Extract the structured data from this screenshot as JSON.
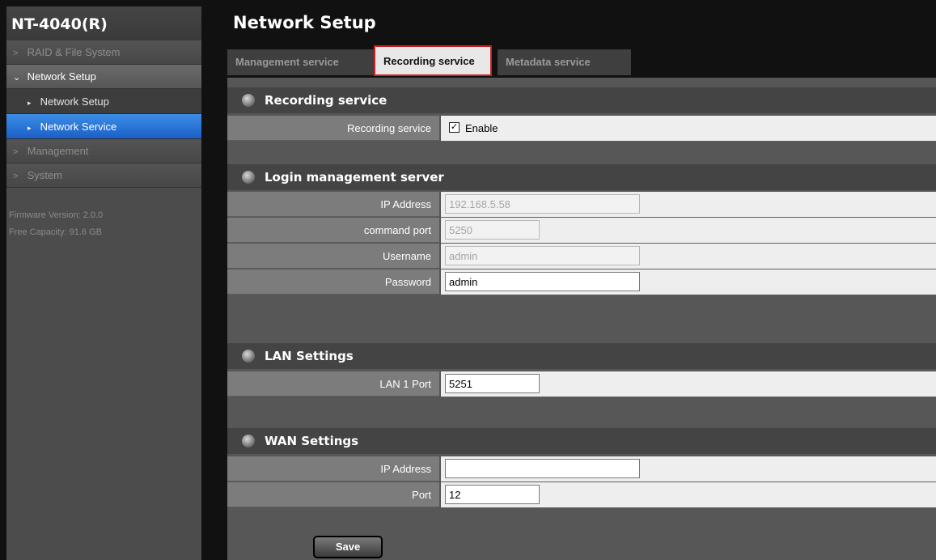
{
  "sidebar": {
    "device_title": "NT-4040(R)",
    "menu": [
      {
        "label": "RAID & File System",
        "icon": "chevron-right-icon"
      },
      {
        "label": "Network Setup",
        "icon": "chevron-down-icon",
        "expanded": true
      },
      {
        "label": "Management",
        "icon": "chevron-right-icon"
      },
      {
        "label": "System",
        "icon": "chevron-right-icon"
      }
    ],
    "submenu": [
      {
        "label": "Network Setup",
        "active": false
      },
      {
        "label": "Network Service",
        "active": true
      }
    ],
    "firmware_version": "Firmware Version: 2.0.0",
    "free_capacity": "Free Capacity: 91.6 GB"
  },
  "main": {
    "title": "Network Setup",
    "tabs": [
      {
        "label": "Management service",
        "active": false
      },
      {
        "label": "Recording service",
        "active": true
      },
      {
        "label": "Metadata service",
        "active": false
      }
    ]
  },
  "recording_service": {
    "header": "Recording service",
    "enable_row_label": "Recording service",
    "enable_checked": true,
    "enable_checkbox_glyph": "✓",
    "enable_text": "Enable"
  },
  "login_server": {
    "header": "Login management server",
    "ip_label": "IP Address",
    "ip_value": "192.168.5.58",
    "port_label": "command port",
    "port_value": "5250",
    "username_label": "Username",
    "username_value": "admin",
    "password_label": "Password",
    "password_value": "admin"
  },
  "lan": {
    "header": "LAN Settings",
    "port_label": "LAN 1 Port",
    "port_value": "5251"
  },
  "wan": {
    "header": "WAN Settings",
    "ip_label": "IP Address",
    "ip_value": "",
    "port_label": "Port",
    "port_value": "12"
  },
  "actions": {
    "save_label": "Save"
  },
  "colors": {
    "active_submenu": "#1b5fc8",
    "active_tab_border": "#cc1f1f",
    "panel_bg": "#575757"
  }
}
